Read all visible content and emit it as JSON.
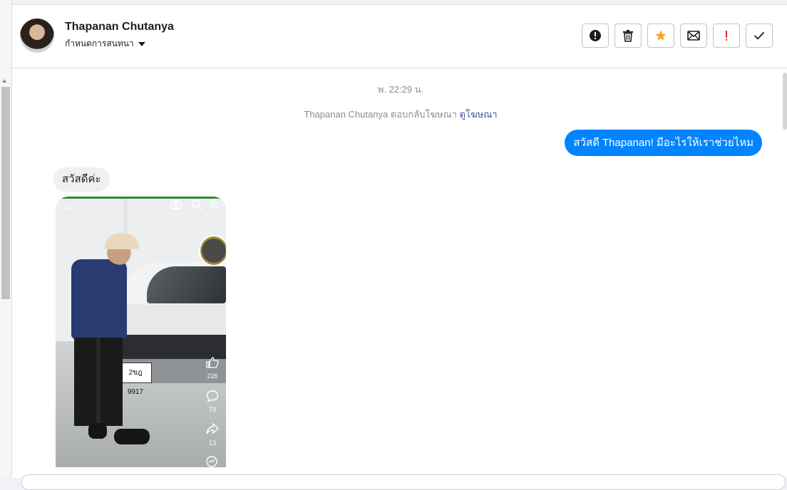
{
  "header": {
    "contact_name": "Thapanan Chutanya",
    "convo_menu_label": "กำหนดการสนทนา",
    "actions": [
      {
        "icon": "spam-alert-icon"
      },
      {
        "icon": "trash-icon"
      },
      {
        "icon": "star-icon",
        "color": "#f5a623"
      },
      {
        "icon": "mail-icon"
      },
      {
        "icon": "important-icon",
        "color": "#e4212e"
      },
      {
        "icon": "check-icon"
      }
    ]
  },
  "thread": {
    "timestamp": "พ. 22:29 น.",
    "ad_reply_text": "Thapanan Chutanya ตอบกลับโฆษณา",
    "ad_link": "ดูโฆษณา",
    "outgoing_message": "สวัสดี Thapanan! มีอะไรให้เราช่วยไหม",
    "incoming_message": "สวัสดีค่ะ",
    "photo": {
      "likes": "226",
      "comments": "79",
      "shares": "13",
      "plate": "2ขฎ 9917"
    }
  },
  "colors": {
    "outgoing_bubble": "#0084ff",
    "incoming_bubble": "#f0f0f0",
    "link": "#385898"
  }
}
